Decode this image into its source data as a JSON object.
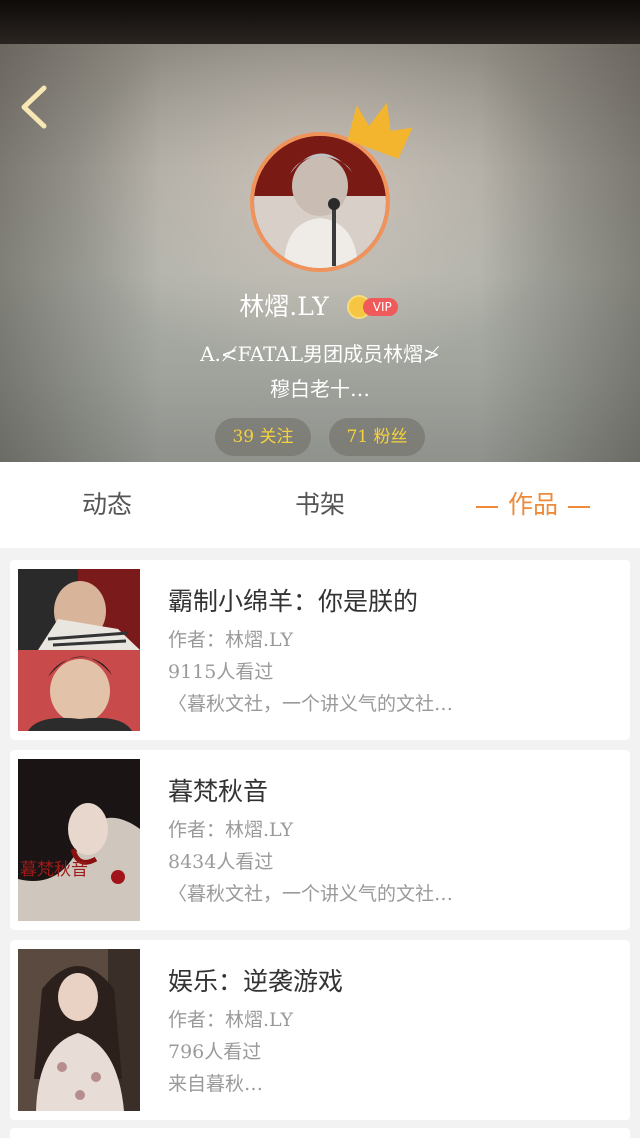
{
  "profile": {
    "username": "林熠.LY",
    "vip_badge": "VIP",
    "bio_line1": "A.≮FATAL男团成员林熠≯",
    "bio_line2": "穆白老十…",
    "following_label": "39 关注",
    "fans_label": "71 粉丝"
  },
  "tabs": [
    {
      "label": "动态",
      "active": false
    },
    {
      "label": "书架",
      "active": false
    },
    {
      "label": "作品",
      "active": true
    }
  ],
  "works": [
    {
      "title": "霸制小绵羊：你是朕的",
      "author": "作者：林熠.LY",
      "views": "9115人看过",
      "description": "〈暮秋文社，一个讲义气的文社…"
    },
    {
      "title": "暮梵秋音",
      "author": "作者：林熠.LY",
      "views": "8434人看过",
      "description": "〈暮秋文社，一个讲义气的文社…",
      "cover_text": "暮梵秋音"
    },
    {
      "title": "娱乐：逆袭游戏",
      "author": "作者：林熠.LY",
      "views": "796人看过",
      "description": "来自暮秋…"
    }
  ],
  "colors": {
    "accent": "#ef8a3a",
    "pill_text": "#f6d13e",
    "vip_red": "#f05a5a"
  },
  "icons": {
    "back": "chevron-left-icon",
    "crown": "crown-icon"
  }
}
